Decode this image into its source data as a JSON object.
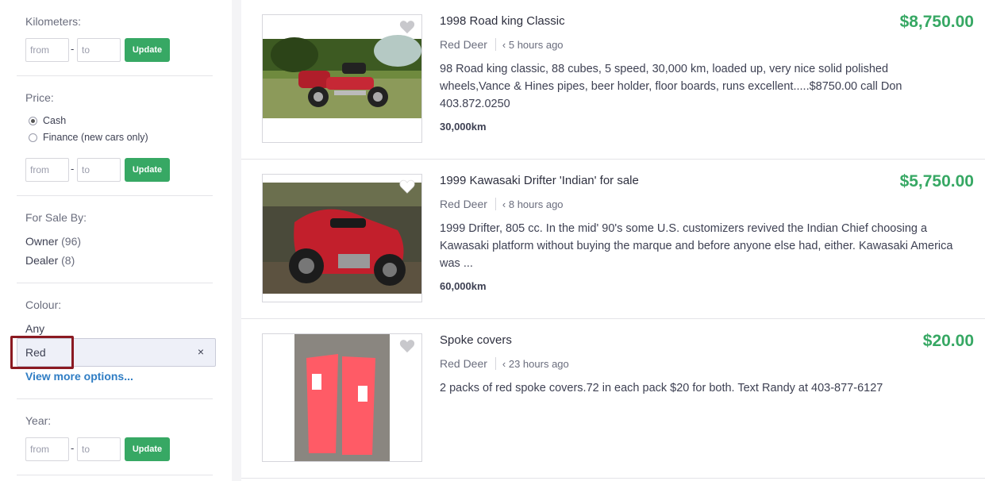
{
  "sidebar": {
    "kilometers": {
      "title": "Kilometers:",
      "from_placeholder": "from",
      "to_placeholder": "to",
      "update_label": "Update"
    },
    "price": {
      "title": "Price:",
      "options": [
        {
          "label": "Cash",
          "checked": true
        },
        {
          "label": "Finance (new cars only)",
          "checked": false
        }
      ],
      "from_placeholder": "from",
      "to_placeholder": "to",
      "update_label": "Update"
    },
    "for_sale_by": {
      "title": "For Sale By:",
      "items": [
        {
          "label": "Owner",
          "count": "(96)"
        },
        {
          "label": "Dealer",
          "count": "(8)"
        }
      ]
    },
    "colour": {
      "title": "Colour:",
      "any_label": "Any",
      "selected": "Red",
      "remove_symbol": "×",
      "view_more": "View more options..."
    },
    "year": {
      "title": "Year:",
      "from_placeholder": "from",
      "to_placeholder": "to",
      "update_label": "Update"
    }
  },
  "listings": [
    {
      "title": "1998 Road king Classic",
      "price": "$8,750.00",
      "location": "Red Deer",
      "time": "‹ 5 hours ago",
      "description": "98 Road king classic, 88 cubes, 5 speed, 30,000 km, loaded up, very nice solid polished wheels,Vance & Hines pipes, beer holder, floor boards, runs excellent.....$8750.00 call Don 403.872.0250",
      "km": "30,000km"
    },
    {
      "title": "1999 Kawasaki Drifter 'Indian' for sale",
      "price": "$5,750.00",
      "location": "Red Deer",
      "time": "‹ 8 hours ago",
      "description": "1999 Drifter, 805 cc. In the mid' 90's some U.S. customizers revived the Indian Chief choosing a Kawasaki platform without buying the marque and before anyone else had, either. Kawasaki America was ...",
      "km": "60,000km"
    },
    {
      "title": "Spoke covers",
      "price": "$20.00",
      "location": "Red Deer",
      "time": "‹ 23 hours ago",
      "description": "2 packs of red spoke covers.72 in each pack $20 for both. Text Randy at 403-877-6127",
      "km": ""
    }
  ],
  "colors": {
    "price_green": "#37a864",
    "link_blue": "#2f7dc4",
    "highlight_red": "#8b1a22"
  },
  "icons": {
    "favorite": "heart-icon",
    "remove": "close-icon"
  }
}
